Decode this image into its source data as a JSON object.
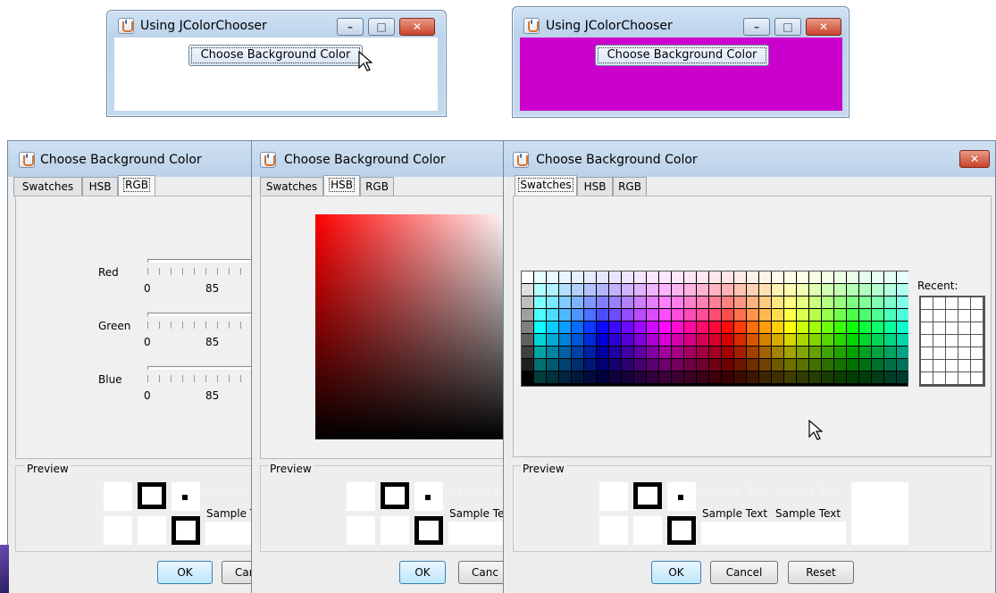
{
  "windows": [
    {
      "title": "Using JColorChooser",
      "button_label": "Choose Background Color",
      "background": "#ffffff"
    },
    {
      "title": "Using JColorChooser",
      "button_label": "Choose Background Color",
      "background": "#cc00cc"
    }
  ],
  "window_controls": {
    "minimize": "–",
    "maximize": "□",
    "close": "✕"
  },
  "dialog": {
    "title": "Choose Background Color",
    "tabs": [
      "Swatches",
      "HSB",
      "RGB"
    ],
    "tab_mnemonics": [
      "S",
      "H",
      "G"
    ],
    "preview_label": "Preview",
    "sample_text": "Sample Text",
    "sample_text_cut": "Sample T",
    "sample_text_cut2": "Sample Te",
    "sample_text_cut_light": "Sample",
    "sample_text_cut_light2": "Sample Tex",
    "buttons": {
      "ok": "OK",
      "cancel": "Cancel",
      "reset": "Reset",
      "cancel_cut": "Can",
      "cancel_cut2": "Canc"
    },
    "recent_label": "Recent:"
  },
  "rgb_panel": {
    "sliders": [
      {
        "label": "Red",
        "ticks": [
          "0",
          "85"
        ]
      },
      {
        "label": "Green",
        "ticks": [
          "0",
          "85"
        ]
      },
      {
        "label": "Blue",
        "ticks": [
          "0",
          "85"
        ]
      }
    ]
  },
  "colors": {
    "accent_magenta": "#cc00cc",
    "hsb_hue": "#ff0000",
    "titlebar": "#c6d9ed"
  }
}
